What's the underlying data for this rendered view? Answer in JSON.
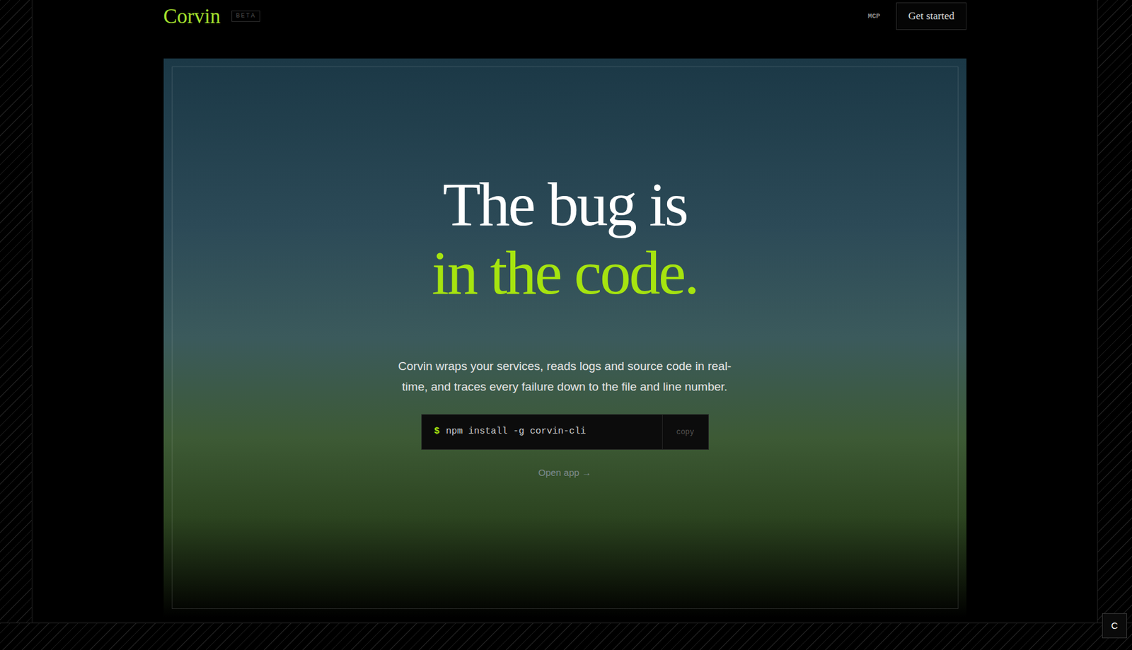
{
  "header": {
    "logo": "Corvin",
    "badge": "BETA",
    "nav": [
      {
        "label": "MCP"
      }
    ],
    "cta": "Get started"
  },
  "hero": {
    "headline_line1": "The bug is",
    "headline_line2": "in the code.",
    "description": "Corvin wraps your services, reads logs and source code in real-time, and traces every failure down to the file and line number.",
    "command": {
      "prompt": "$",
      "text": "npm install -g corvin-cli",
      "copy": "copy"
    },
    "link": "Open app →"
  },
  "floating_button": {
    "label": "C"
  }
}
